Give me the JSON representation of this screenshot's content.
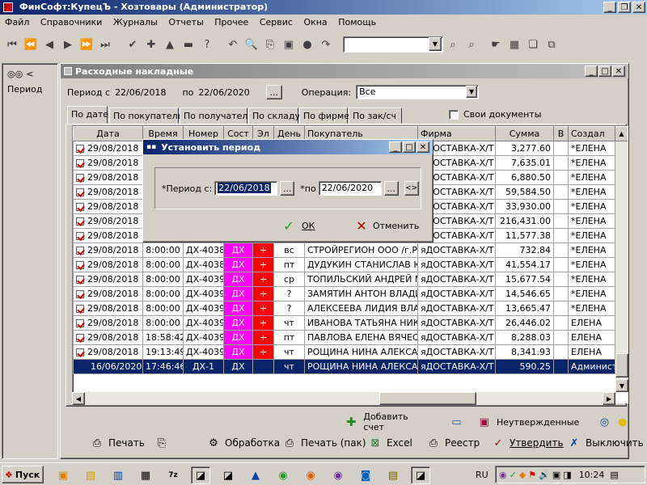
{
  "app": {
    "title": "ФинСофт:КупецЪ - Хозтовары  (Администратор)"
  },
  "menu": [
    "Файл",
    "Справочники",
    "Журналы",
    "Отчеты",
    "Прочее",
    "Сервис",
    "Окна",
    "Помощь"
  ],
  "left_panel": {
    "label": "Период",
    "arrow": "<"
  },
  "doc_window": {
    "title": "Расходные накладные",
    "period_from_label": "Период с",
    "period_from": "22/06/2018",
    "period_to_label": "по",
    "period_to": "22/06/2020",
    "ellipsis": "...",
    "operation_label": "Операция:",
    "operation_value": "Все",
    "tabs": [
      "По дате",
      "По покупателю",
      "По получателю",
      "По складу",
      "По фирме",
      "По зак/сч"
    ],
    "own_docs_label": "Свои документы"
  },
  "table": {
    "headers": [
      "Дата",
      "Время",
      "Номер",
      "Сост",
      "Эл",
      "День",
      "Покупатель",
      "Фирма",
      "Сумма",
      "В",
      "Создал"
    ],
    "rows": [
      {
        "date": "29/08/2018",
        "time": "",
        "num": "",
        "sost": "",
        "el": "",
        "day": "",
        "buyer": "",
        "firm": "яДОСТАВКА-Х/Т",
        "sum": "3,277.60",
        "creator": "*ЕЛЕНА"
      },
      {
        "date": "29/08/2018",
        "time": "",
        "num": "",
        "sost": "",
        "el": "",
        "day": "",
        "buyer": "",
        "firm": "яДОСТАВКА-Х/Т",
        "sum": "7,635.01",
        "creator": "*ЕЛЕНА"
      },
      {
        "date": "29/08/2018",
        "time": "",
        "num": "",
        "sost": "",
        "el": "",
        "day": "",
        "buyer": "",
        "firm": "яДОСТАВКА-Х/Т",
        "sum": "6,880.50",
        "creator": "*ЕЛЕНА"
      },
      {
        "date": "29/08/2018",
        "time": "",
        "num": "",
        "sost": "",
        "el": "",
        "day": "",
        "buyer": "",
        "firm": "яДОСТАВКА-Х/Т",
        "sum": "59,584.50",
        "creator": "*ЕЛЕНА"
      },
      {
        "date": "29/08/2018",
        "time": "",
        "num": "",
        "sost": "",
        "el": "",
        "day": "",
        "buyer": "",
        "firm": "яДОСТАВКА-Х/Т",
        "sum": "33,930.00",
        "creator": "*ЕЛЕНА"
      },
      {
        "date": "29/08/2018",
        "time": "",
        "num": "",
        "sost": "",
        "el": "",
        "day": "",
        "buyer": "",
        "firm": "яДОСТАВКА-Х/Т",
        "sum": "216,431.00",
        "creator": "*ЕЛЕНА"
      },
      {
        "date": "29/08/2018",
        "time": "",
        "num": "",
        "sost": "",
        "el": "",
        "day": "",
        "buyer": "",
        "firm": "яДОСТАВКА-Х/Т",
        "sum": "11,577.38",
        "creator": "*ЕЛЕНА"
      },
      {
        "date": "29/08/2018",
        "time": "8:00:00",
        "num": "ДХ-40388",
        "sost": "ДХ",
        "el": "+",
        "day": "вс",
        "buyer": "СТРОЙРЕГИОН ООО /г.Ря",
        "firm": "яДОСТАВКА-Х/Т",
        "sum": "732.84",
        "creator": "*ЕЛЕНА"
      },
      {
        "date": "29/08/2018",
        "time": "8:00:00",
        "num": "ДХ-40389",
        "sost": "ДХ",
        "el": "+",
        "day": "пт",
        "buyer": "ДУДУКИН СТАНИСЛАВ Ю",
        "firm": "яДОСТАВКА-Х/Т",
        "sum": "41,554.17",
        "creator": "*ЕЛЕНА"
      },
      {
        "date": "29/08/2018",
        "time": "8:00:00",
        "num": "ДХ-40390",
        "sost": "ДХ",
        "el": "+",
        "day": "ср",
        "buyer": "ТОПИЛЬСКИЙ АНДРЕЙ М",
        "firm": "яДОСТАВКА-Х/Т",
        "sum": "15,677.54",
        "creator": "*ЕЛЕНА"
      },
      {
        "date": "29/08/2018",
        "time": "8:00:00",
        "num": "ДХ-40391",
        "sost": "ДХ",
        "el": "+",
        "day": "?",
        "buyer": "ЗАМЯТИН АНТОН ВЛАДИ",
        "firm": "яДОСТАВКА-Х/Т",
        "sum": "14,546.65",
        "creator": "*ЕЛЕНА"
      },
      {
        "date": "29/08/2018",
        "time": "8:00:00",
        "num": "ДХ-40392",
        "sost": "ДХ",
        "el": "+",
        "day": "?",
        "buyer": "АЛЕКСЕЕВА ЛИДИЯ ВЛАД",
        "firm": "яДОСТАВКА-Х/Т",
        "sum": "13,665.47",
        "creator": "*ЕЛЕНА"
      },
      {
        "date": "29/08/2018",
        "time": "8:00:00",
        "num": "ДХ-40393",
        "sost": "ДХ",
        "el": "+",
        "day": "чт",
        "buyer": "ИВАНОВА ТАТЬЯНА НИКО",
        "firm": "яДОСТАВКА-Х/Т",
        "sum": "26,446.02",
        "creator": "ЕЛЕНА"
      },
      {
        "date": "29/08/2018",
        "time": "18:58:42",
        "num": "ДХ-40395",
        "sost": "ДХ",
        "el": "+",
        "day": "пт",
        "buyer": "ПАВЛОВА ЕЛЕНА ВЯЧЕСЛ",
        "firm": "яДОСТАВКА-Х/Т",
        "sum": "8,288.03",
        "creator": "ЕЛЕНА"
      },
      {
        "date": "29/08/2018",
        "time": "19:13:49",
        "num": "ДХ-40396",
        "sost": "ДХ",
        "el": "+",
        "day": "чт",
        "buyer": "РОЩИНА НИНА АЛЕКСАН",
        "firm": "яДОСТАВКА-Х/Т",
        "sum": "8,341.93",
        "creator": "ЕЛЕНА"
      },
      {
        "date": "16/06/2020",
        "time": "17:46:46",
        "num": "ДХ-1",
        "sost": "ДХ",
        "el": "",
        "day": "чт",
        "buyer": "РОЩИНА НИНА АЛЕКСАН",
        "firm": "яДОСТАВКА-Х/Т",
        "sum": "590.25",
        "creator": "Администр",
        "selected": true
      }
    ]
  },
  "footer_actions": {
    "add_invoice": "Добавить счет",
    "unconfirmed": "Неутвержденные"
  },
  "bottom_buttons": [
    "Печать",
    "Обработка",
    "Печать (пак)",
    "Excel",
    "Реестр",
    "Утвердить",
    "Выключить"
  ],
  "dialog": {
    "title": "Установить период",
    "from_label": "*Период с:",
    "from_value": "22/06/2018",
    "to_label": "*по",
    "to_value": "22/06/2020",
    "ellipsis": "...",
    "swap": "<>",
    "ok": "ОК",
    "cancel": "Отменить"
  },
  "taskbar": {
    "start": "Пуск",
    "lang": "RU",
    "clock": "10:24"
  }
}
